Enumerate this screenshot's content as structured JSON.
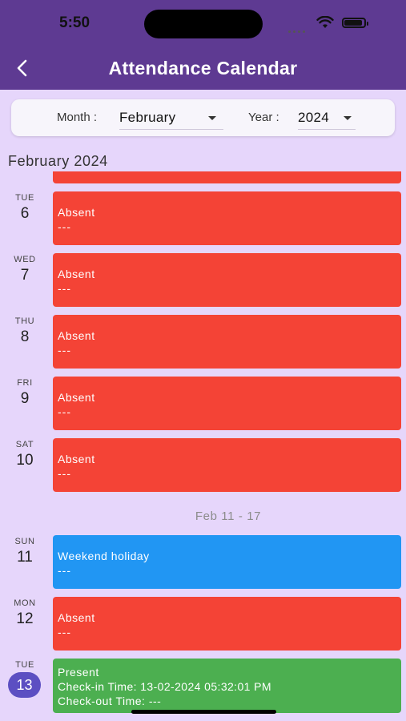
{
  "status_bar": {
    "time": "5:50"
  },
  "header": {
    "title": "Attendance Calendar",
    "back_icon": "chevron-left-icon"
  },
  "filter": {
    "month_label": "Month :",
    "month_value": "February",
    "year_label": "Year :",
    "year_value": "2024"
  },
  "month_heading": "February 2024",
  "days": [
    {
      "dow": "TUE",
      "day": "6",
      "status": "Absent",
      "detail": "---"
    },
    {
      "dow": "WED",
      "day": "7",
      "status": "Absent",
      "detail": "---"
    },
    {
      "dow": "THU",
      "day": "8",
      "status": "Absent",
      "detail": "---"
    },
    {
      "dow": "FRI",
      "day": "9",
      "status": "Absent",
      "detail": "---"
    },
    {
      "dow": "SAT",
      "day": "10",
      "status": "Absent",
      "detail": "---"
    },
    {
      "dow": "SUN",
      "day": "11",
      "status": "Weekend holiday",
      "detail": "---"
    },
    {
      "dow": "MON",
      "day": "12",
      "status": "Absent",
      "detail": "---"
    },
    {
      "dow": "TUE",
      "day": "13",
      "status": "Present",
      "detail": "Check-in Time: 13-02-2024 05:32:01 PM",
      "detail2": "Check-out Time: ---"
    }
  ],
  "week_separator": "Feb 11 - 17",
  "colors": {
    "header": "#5e3a92",
    "background": "#e6d6fb",
    "absent": "#f44336",
    "holiday": "#2196f3",
    "present": "#4caf50",
    "today_badge": "#5c4fc2"
  }
}
